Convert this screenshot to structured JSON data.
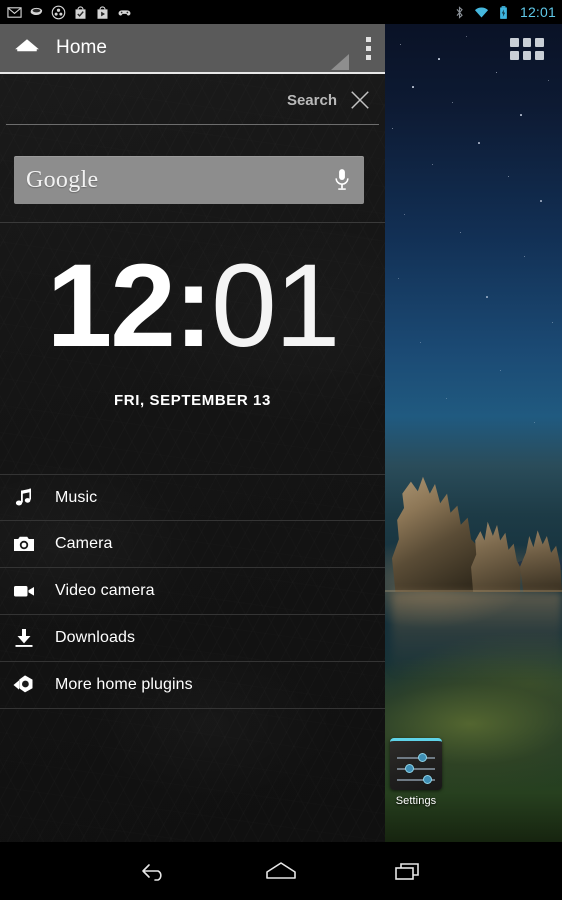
{
  "statusbar": {
    "time": "12:01",
    "time_color": "#5fc8e8",
    "left_icons": [
      {
        "name": "gmail-icon",
        "label": "Gmail"
      },
      {
        "name": "hangouts-icon",
        "label": "Hangouts"
      },
      {
        "name": "google-plus-icon",
        "label": "Google+"
      },
      {
        "name": "play-store-update-icon",
        "label": "Play Store update"
      },
      {
        "name": "play-store-icon",
        "label": "Play Store"
      },
      {
        "name": "games-controller-icon",
        "label": "Play Games"
      }
    ],
    "right_icons": [
      {
        "name": "bluetooth-icon",
        "label": "Bluetooth"
      },
      {
        "name": "wifi-icon",
        "label": "Wi-Fi"
      },
      {
        "name": "battery-charging-icon",
        "label": "Battery charging"
      }
    ]
  },
  "panel": {
    "actionbar": {
      "title": "Home",
      "home_icon": "home-icon",
      "overflow_label": "More options"
    },
    "search": {
      "label": "Search",
      "close_icon": "close-x-icon"
    },
    "google_widget": {
      "text": "Google",
      "mic_icon": "microphone-icon"
    },
    "clock": {
      "hour": "12",
      "separator": ":",
      "minute": "01",
      "date": "FRI, SEPTEMBER 13"
    },
    "plugins": [
      {
        "icon": "music-note-icon",
        "label": "Music"
      },
      {
        "icon": "camera-icon",
        "label": "Camera"
      },
      {
        "icon": "video-camera-icon",
        "label": "Video camera"
      },
      {
        "icon": "download-icon",
        "label": "Downloads"
      },
      {
        "icon": "home-plugins-icon",
        "label": "More home plugins"
      }
    ]
  },
  "homescreen": {
    "app_drawer_label": "Apps",
    "shortcuts": [
      {
        "icon": "settings-sliders-icon",
        "label": "Settings",
        "accent": "#5fd3e8"
      }
    ]
  },
  "navbar": {
    "buttons": [
      {
        "name": "back-button",
        "label": "Back"
      },
      {
        "name": "home-button",
        "label": "Home"
      },
      {
        "name": "recents-button",
        "label": "Recent apps"
      }
    ]
  }
}
